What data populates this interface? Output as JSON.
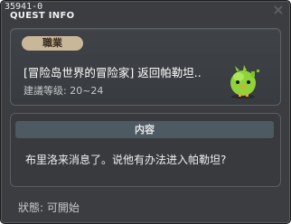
{
  "window": {
    "quest_id": "35941-0",
    "title": "QUEST INFO",
    "close_icon": "close-icon"
  },
  "quest": {
    "category": "職業",
    "name": "[冒险岛世界的冒险家] 返回帕勒坦..",
    "level": "建議等级: 20~24",
    "npc_icon": "green-chick-npc-icon"
  },
  "content": {
    "header": "内容",
    "body": "布里洛来消息了。说他有办法进入帕勒坦?"
  },
  "status": {
    "text": "狀態:  可開始"
  },
  "colors": {
    "window_bg": "#3b3d40",
    "badge_bg": "#c9b79a",
    "header_bg": "#4d5a61",
    "npc_green": "#8fd23a"
  }
}
